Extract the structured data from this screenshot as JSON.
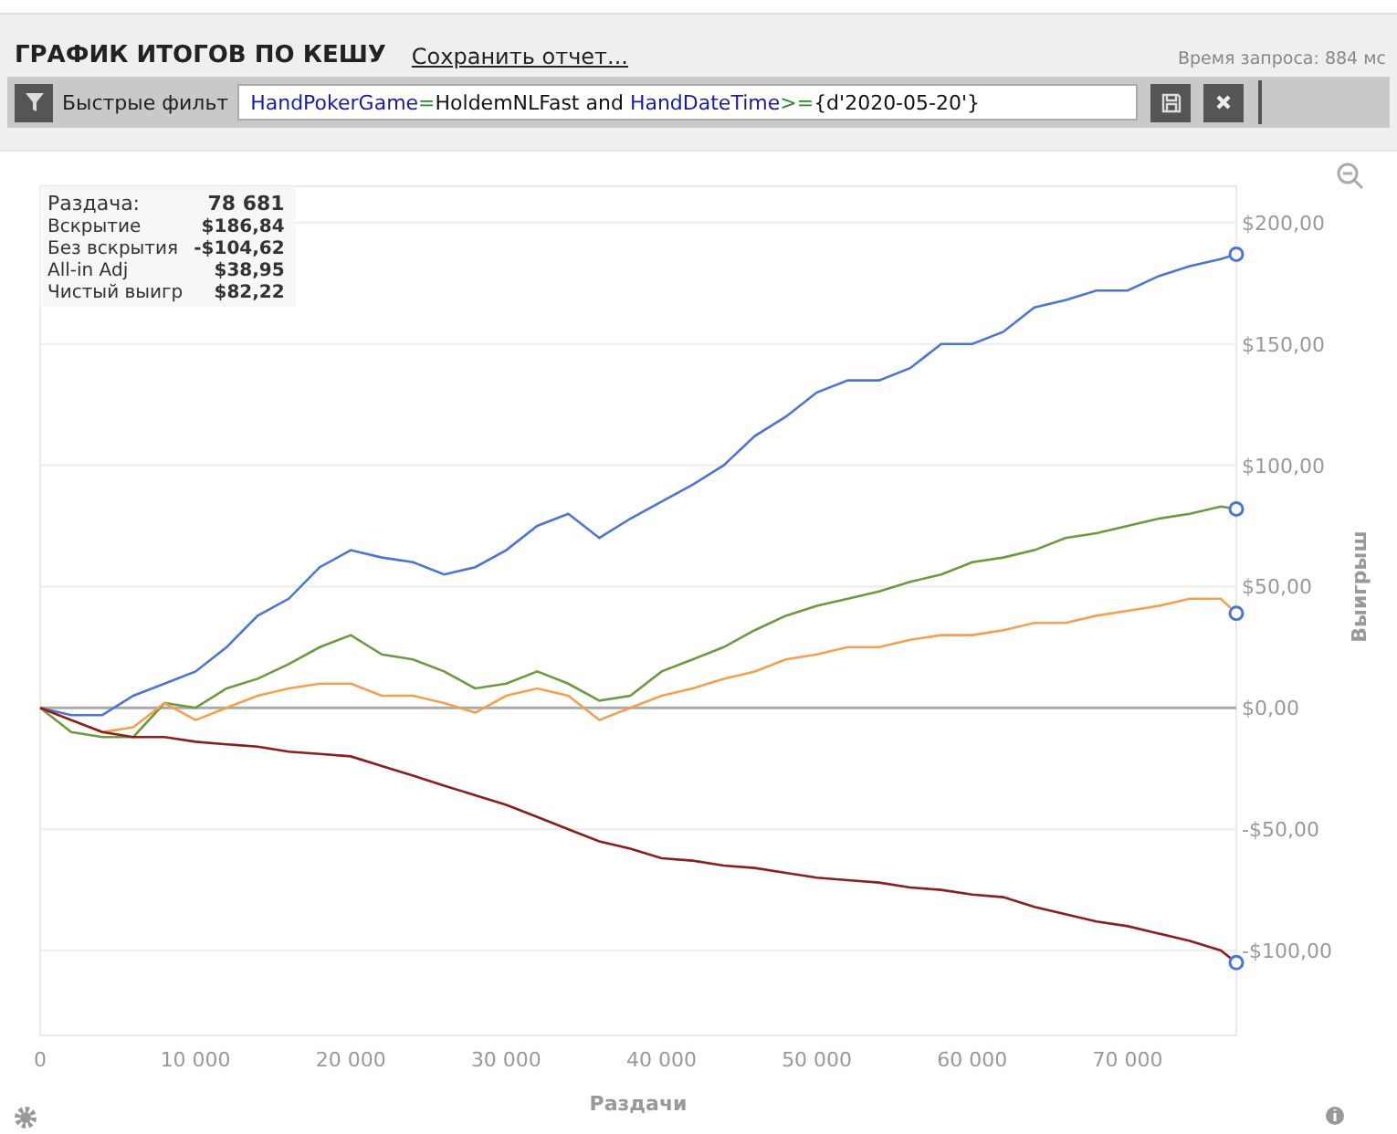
{
  "header": {
    "title": "ГРАФИК ИТОГОВ ПО КЕШУ",
    "save_report_link": "Сохранить отчет...",
    "query_time": "Время запроса: 884 мс"
  },
  "filter": {
    "label": "Быстрые фильт",
    "query": [
      {
        "kind": "field",
        "text": "HandPokerGame"
      },
      {
        "kind": "op",
        "text": "="
      },
      {
        "kind": "value",
        "text": "HoldemNLFast and "
      },
      {
        "kind": "field",
        "text": "HandDateTime"
      },
      {
        "kind": "op",
        "text": ">="
      },
      {
        "kind": "value",
        "text": "{d'2020-05-20'}"
      }
    ]
  },
  "stats": [
    {
      "kind": "total",
      "label": "Раздача:",
      "value": "78 681"
    },
    {
      "kind": "row",
      "label": "Вскрытие",
      "value": "$186,84"
    },
    {
      "kind": "row",
      "label": "Без вскрытия",
      "value": "-$104,62"
    },
    {
      "kind": "row",
      "label": "All-in Adj",
      "value": "$38,95"
    },
    {
      "kind": "row",
      "label": "Чистый выигр",
      "value": "$82,22"
    }
  ],
  "chart_data": {
    "type": "line",
    "grid": true,
    "xlabel": "Раздачи",
    "ylabel": "Выигрыш",
    "x": [
      0,
      2000,
      4000,
      6000,
      8000,
      10000,
      12000,
      14000,
      16000,
      18000,
      20000,
      22000,
      24000,
      26000,
      28000,
      30000,
      32000,
      34000,
      36000,
      38000,
      40000,
      42000,
      44000,
      46000,
      48000,
      50000,
      52000,
      54000,
      56000,
      58000,
      60000,
      62000,
      64000,
      66000,
      68000,
      70000,
      72000,
      74000,
      76000,
      77000
    ],
    "xlim": [
      0,
      77000
    ],
    "ylim": [
      -135,
      215
    ],
    "xticks": [
      {
        "value": 0,
        "label": "0"
      },
      {
        "value": 10000,
        "label": "10 000"
      },
      {
        "value": 20000,
        "label": "20 000"
      },
      {
        "value": 30000,
        "label": "30 000"
      },
      {
        "value": 40000,
        "label": "40 000"
      },
      {
        "value": 50000,
        "label": "50 000"
      },
      {
        "value": 60000,
        "label": "60 000"
      },
      {
        "value": 70000,
        "label": "70 000"
      }
    ],
    "yticks": [
      {
        "value": 200,
        "label": "$200,00"
      },
      {
        "value": 150,
        "label": "$150,00"
      },
      {
        "value": 100,
        "label": "$100,00"
      },
      {
        "value": 50,
        "label": "$50,00"
      },
      {
        "value": 0,
        "label": "$0,00"
      },
      {
        "value": -50,
        "label": "-$50,00"
      },
      {
        "value": -100,
        "label": "-$100,00"
      }
    ],
    "series": [
      {
        "color": "#4a74dc",
        "values": [
          0,
          -3,
          -3,
          5,
          10,
          15,
          25,
          38,
          45,
          58,
          65,
          62,
          60,
          55,
          58,
          65,
          75,
          80,
          70,
          78,
          85,
          92,
          100,
          112,
          120,
          130,
          135,
          135,
          140,
          150,
          150,
          155,
          165,
          168,
          172,
          172,
          178,
          182,
          185,
          187
        ]
      },
      {
        "color": "#6c9a3c",
        "values": [
          0,
          -10,
          -12,
          -12,
          2,
          0,
          8,
          12,
          18,
          25,
          30,
          22,
          20,
          15,
          8,
          10,
          15,
          10,
          3,
          5,
          15,
          20,
          25,
          32,
          38,
          42,
          45,
          48,
          52,
          55,
          60,
          62,
          65,
          70,
          72,
          75,
          78,
          80,
          83,
          82
        ]
      },
      {
        "color": "#f5a04a",
        "values": [
          0,
          -5,
          -10,
          -8,
          2,
          -5,
          0,
          5,
          8,
          10,
          10,
          5,
          5,
          2,
          -2,
          5,
          8,
          5,
          -5,
          0,
          5,
          8,
          12,
          15,
          20,
          22,
          25,
          25,
          28,
          30,
          30,
          32,
          35,
          35,
          38,
          40,
          42,
          45,
          45,
          39
        ]
      },
      {
        "color": "#8e1c1c",
        "values": [
          0,
          -5,
          -10,
          -12,
          -12,
          -14,
          -15,
          -16,
          -18,
          -19,
          -20,
          -24,
          -28,
          -32,
          -36,
          -40,
          -45,
          -50,
          -55,
          -58,
          -62,
          -63,
          -65,
          -66,
          -68,
          -70,
          -71,
          -72,
          -74,
          -75,
          -77,
          -78,
          -82,
          -85,
          -88,
          -90,
          -93,
          -96,
          -100,
          -105
        ]
      }
    ]
  }
}
